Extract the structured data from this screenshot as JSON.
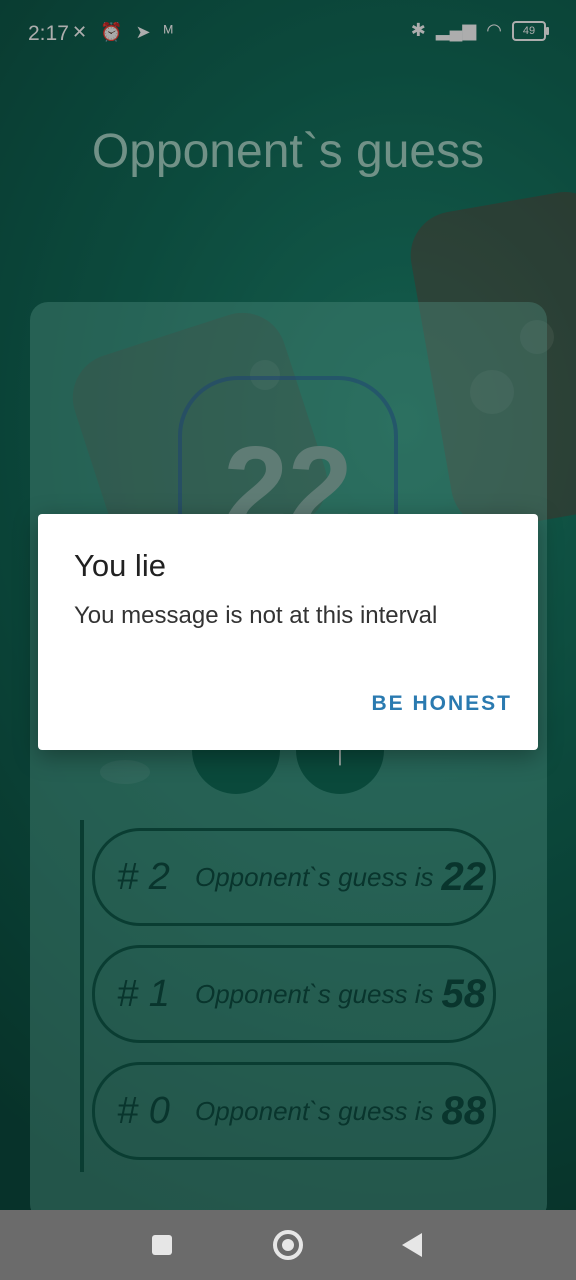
{
  "status_bar": {
    "time": "2:17",
    "left_icons": [
      "muted-vibrate-icon",
      "alarm-icon",
      "telegram-icon",
      "signal-indicator-icon"
    ],
    "right_icons": [
      "bluetooth-icon",
      "cell-signal-icon",
      "wifi-icon"
    ],
    "battery_level": "49"
  },
  "screen": {
    "title": "Opponent`s guess",
    "guess_value": "22",
    "buttons": {
      "left_label": "",
      "right_label": "↑"
    }
  },
  "history": [
    {
      "index": "# 2",
      "text": "Opponent`s guess is",
      "value": "22"
    },
    {
      "index": "# 1",
      "text": "Opponent`s guess is",
      "value": "58"
    },
    {
      "index": "# 0",
      "text": "Opponent`s guess is",
      "value": "88"
    }
  ],
  "dialog": {
    "title": "You lie",
    "message": "You message is not at this interval",
    "button_label": "BE HONEST"
  },
  "nav_bar": {
    "icons": [
      "recent-apps-icon",
      "home-icon",
      "back-icon"
    ]
  }
}
